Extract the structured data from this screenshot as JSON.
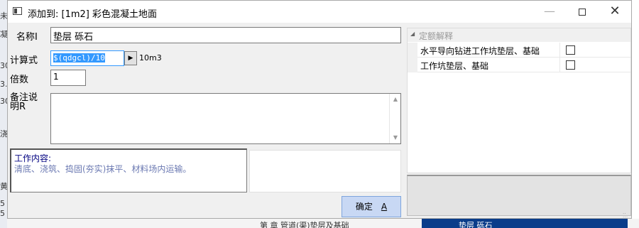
{
  "background": {
    "left_fragments": [
      "未",
      "凝",
      "30",
      "3.",
      "30",
      "浇",
      "5",
      "5",
      "黄"
    ],
    "bottom_text": "第    章  管道(渠)垫层及基础",
    "bottom_highlight_text": "垫层  砾石",
    "highlight_color": "#0a3d8a"
  },
  "window": {
    "title": "添加到: [1m2] 彩色混凝土地面",
    "minimize_icon": "minimize-icon",
    "maximize_icon": "maximize-icon",
    "close_icon": "close-icon"
  },
  "form": {
    "name_label": "名称I",
    "name_value": "垫层 砾石",
    "formula_label": "计算式",
    "formula_value": "$(qdgcl)/10",
    "formula_button_icon": "triangle-right-icon",
    "unit": "10m3",
    "multiplier_label": "倍数",
    "multiplier_value": "1",
    "remark_label": "备注说明R",
    "remark_value": ""
  },
  "work_content": {
    "heading": "工作内容:",
    "text": "清底、浇筑、捣固(夯实)抹平、材料场内运输。"
  },
  "ok_button": {
    "label": "确定",
    "shortcut": "A"
  },
  "property_grid": {
    "category": "定额解释",
    "rows": [
      {
        "label": "水平导向钻进工作坑垫层、基础",
        "checked": false
      },
      {
        "label": "工作坑垫层、基础",
        "checked": false
      }
    ]
  },
  "colors": {
    "accent_blue": "#3399ff",
    "button_bg": "#c8d8f4",
    "work_heading": "#000080",
    "work_text": "#6b79b2"
  }
}
